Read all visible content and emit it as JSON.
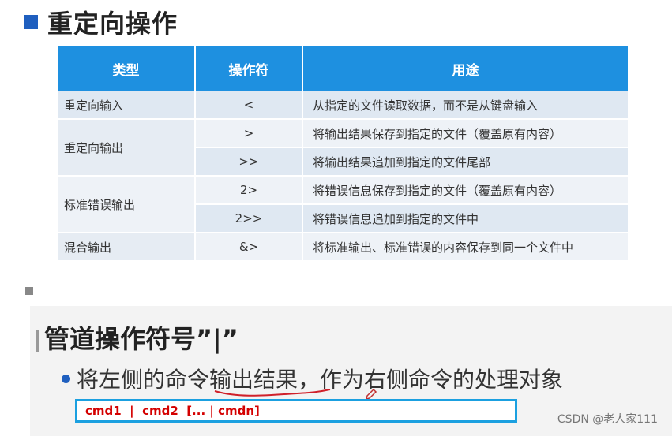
{
  "section1": {
    "title": "重定向操作",
    "table": {
      "headers": [
        "类型",
        "操作符",
        "用途"
      ],
      "rows": [
        {
          "type": "重定向输入",
          "op": "<",
          "use": "从指定的文件读取数据，而不是从键盘输入"
        },
        {
          "type": "重定向输出",
          "op": ">",
          "use": "将输出结果保存到指定的文件（覆盖原有内容）"
        },
        {
          "type": "",
          "op": ">>",
          "use": "将输出结果追加到指定的文件尾部"
        },
        {
          "type": "标准错误输出",
          "op": "2>",
          "use": "将错误信息保存到指定的文件（覆盖原有内容）"
        },
        {
          "type": "",
          "op": "2>>",
          "use": "将错误信息追加到指定的文件中"
        },
        {
          "type": "混合输出",
          "op": "&>",
          "use": "将标准输出、标准错误的内容保存到同一个文件中"
        }
      ]
    }
  },
  "section2": {
    "title": "管道操作符号”|”",
    "bullet_prefix": "将左侧的命令",
    "bullet_emph": "输出结果",
    "bullet_suffix": "，作为右侧命令的处理对象",
    "command": "cmd1  |  cmd2  [... | cmdn]"
  },
  "watermark": "CSDN @老人家111",
  "colors": {
    "header_bg": "#1e90e0",
    "accent": "#1f5fbf",
    "command_text": "#d40000",
    "command_border": "#1ba0e0"
  }
}
